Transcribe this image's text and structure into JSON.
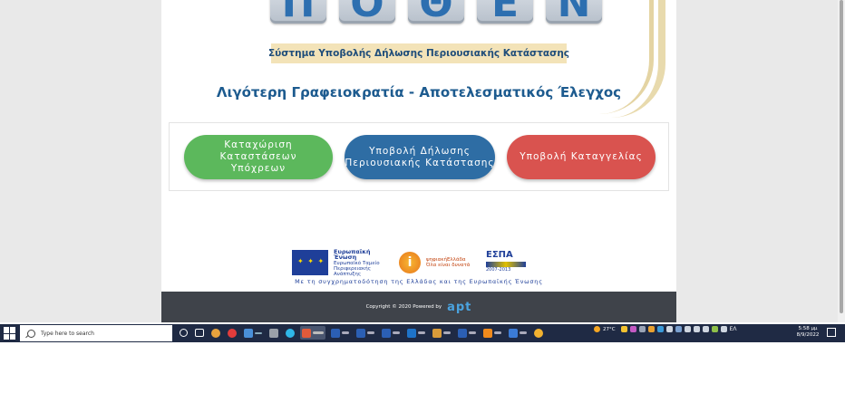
{
  "logo": {
    "letters": [
      "Π",
      "Ο",
      "Θ",
      "Ε",
      "Ν"
    ]
  },
  "subtitle": "Σύστημα Υποβολής Δήλωσης Περιουσιακής Κατάστασης",
  "slogan": "Λιγότερη Γραφειοκρατία - Αποτελεσματικός Έλεγχος",
  "buttons": {
    "register": {
      "line1": "Καταχώριση Καταστάσεων",
      "line2": "Υπόχρεων",
      "color": "#5cb85c"
    },
    "submit": {
      "line1": "Υποβολή Δήλωσης",
      "line2": "Περιουσιακής Κατάστασης",
      "color": "#2e6da4"
    },
    "report": {
      "line1": "Υποβολή Καταγγελίας",
      "color": "#d9534f"
    }
  },
  "funding": {
    "eu_title": "Ευρωπαϊκή Ένωση",
    "eu_fund": "Ευρωπαϊκό Ταμείο Περιφερειακής Ανάπτυξης",
    "digital_title": "ψηφιακήΕλλάδα",
    "digital_sub": "Όλα είναι δυνατά",
    "espa_title": "ΕΣΠΑ",
    "espa_years": "2007-2013",
    "cofund": "Με τη συγχρηματοδότηση της Ελλάδας και της Ευρωπαϊκής Ένωσης"
  },
  "footer": {
    "copyright": "Copyright © 2020 Powered by",
    "brand": "apt"
  },
  "taskbar": {
    "search_placeholder": "Type here to search",
    "weather": "27°C",
    "language": "ΕΛ",
    "time": "5:58 μμ",
    "date": "8/9/2022"
  },
  "colors": {
    "accent_blue": "#1d5b8f",
    "subtitle_bg": "#f3e3b8",
    "footer_bg": "#3f434a"
  }
}
